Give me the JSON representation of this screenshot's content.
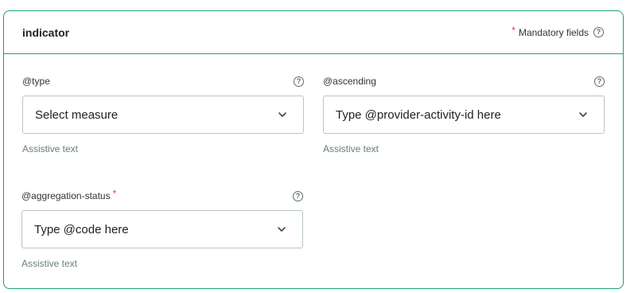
{
  "card": {
    "title": "indicator",
    "mandatory_star": "*",
    "mandatory_label": "Mandatory fields",
    "help_glyph": "?"
  },
  "fields": [
    {
      "label": "@type",
      "required": false,
      "value": "Select measure",
      "assistive": "Assistive text"
    },
    {
      "label": "@ascending",
      "required": false,
      "value": "Type @provider-activity-id here",
      "assistive": "Assistive text"
    },
    {
      "label": "@aggregation-status",
      "required": true,
      "required_mark": "*",
      "value": "Type @code here",
      "assistive": "Assistive text"
    }
  ],
  "colors": {
    "accent": "#1b9e80",
    "required": "#e53935",
    "assistive": "#6b7d7d"
  },
  "icons": {
    "help": "help-circle-icon",
    "dropdown": "chevron-down-icon"
  }
}
